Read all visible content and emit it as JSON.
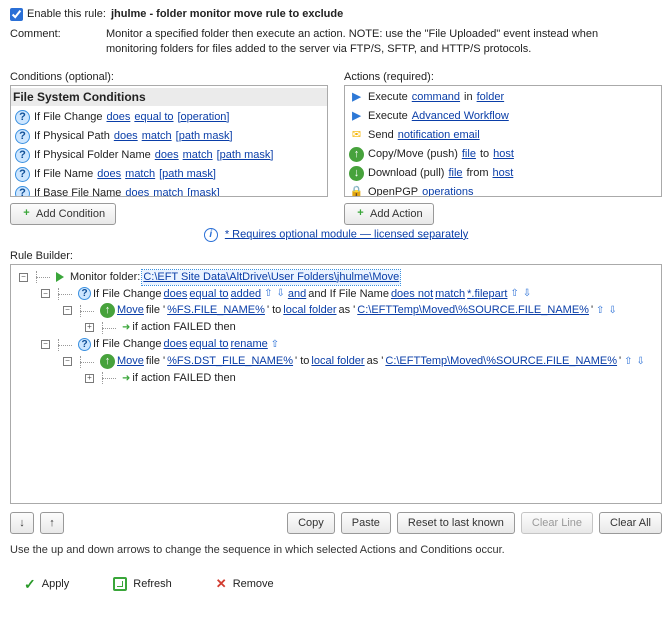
{
  "header": {
    "enable_label": "Enable this rule:",
    "rule_name": "jhulme - folder monitor move rule to exclude",
    "comment_label": "Comment:",
    "comment_text": "Monitor a specified folder then execute an action. NOTE: use the \"File Uploaded\" event instead when monitoring folders for files added to the server via FTP/S, SFTP, and HTTP/S protocols."
  },
  "conditions": {
    "label": "Conditions (optional):",
    "group_header": "File System Conditions",
    "rows": [
      {
        "pre": "If File Change ",
        "a": "does",
        "b": "equal to",
        "c": "[operation]"
      },
      {
        "pre": "If Physical Path ",
        "a": "does",
        "b": "match",
        "c": "[path mask]"
      },
      {
        "pre": "If Physical Folder Name ",
        "a": "does",
        "b": "match",
        "c": "[path mask]"
      },
      {
        "pre": "If File Name ",
        "a": "does",
        "b": "match",
        "c": "[path mask]"
      },
      {
        "pre": "If Base File Name ",
        "a": "does",
        "b": "match",
        "c": "[mask]"
      }
    ],
    "add_button": "Add Condition"
  },
  "actions": {
    "label": "Actions (required):",
    "rows": [
      {
        "icon": "run",
        "parts": [
          [
            "",
            "Execute "
          ],
          [
            "link",
            "command"
          ],
          [
            "",
            " in "
          ],
          [
            "link",
            "folder"
          ]
        ]
      },
      {
        "icon": "run",
        "parts": [
          [
            "",
            "Execute "
          ],
          [
            "link",
            "Advanced Workflow"
          ]
        ]
      },
      {
        "icon": "mail",
        "parts": [
          [
            "",
            "Send "
          ],
          [
            "link",
            "notification email"
          ]
        ]
      },
      {
        "icon": "up",
        "parts": [
          [
            "",
            "Copy/Move (push) "
          ],
          [
            "link",
            "file"
          ],
          [
            "",
            " to "
          ],
          [
            "link",
            "host"
          ]
        ]
      },
      {
        "icon": "down",
        "parts": [
          [
            "",
            "Download (pull) "
          ],
          [
            "link",
            "file"
          ],
          [
            "",
            " from "
          ],
          [
            "link",
            "host"
          ]
        ]
      },
      {
        "icon": "lock",
        "parts": [
          [
            "",
            "OpenPGP "
          ],
          [
            "link",
            "operations"
          ]
        ]
      }
    ],
    "add_button": "Add Action"
  },
  "license": {
    "text": "* Requires optional module — licensed separately"
  },
  "builder": {
    "label": "Rule Builder:",
    "root": {
      "pre": "Monitor folder: ",
      "folder": "C:\\EFT Site Data\\AltDrive\\User Folders\\jhulme\\Move"
    },
    "branches": [
      {
        "cond": {
          "pre1": "If File Change ",
          "a": "does",
          "b": "equal to",
          "c": "added",
          "mid": " and If File Name ",
          "d": "does not",
          "e": "match",
          "f": "*.filepart"
        },
        "action": {
          "pre": " file '",
          "file": "%FS.FILE_NAME%",
          "mid1": "' to ",
          "dest": "local folder",
          "mid2": " as '",
          "as": "C:\\EFTTemp\\Moved\\%SOURCE.FILE_NAME%",
          "post": "' ",
          "verb": "Move"
        },
        "fail": "if action FAILED then"
      },
      {
        "cond": {
          "pre1": "If File Change ",
          "a": "does",
          "b": "equal to",
          "c": "rename"
        },
        "action": {
          "pre": " file '",
          "file": "%FS.DST_FILE_NAME%",
          "mid1": "' to ",
          "dest": "local folder",
          "mid2": " as '",
          "as": "C:\\EFTTemp\\Moved\\%SOURCE.FILE_NAME%",
          "post": "' ",
          "verb": "Move"
        },
        "fail": "if action FAILED then"
      }
    ]
  },
  "bottom": {
    "copy": "Copy",
    "paste": "Paste",
    "reset": "Reset to last known",
    "clear_line": "Clear Line",
    "clear_all": "Clear All"
  },
  "hint": "Use the up and down arrows to change the sequence in which selected Actions and Conditions occur.",
  "legend": {
    "apply": "Apply",
    "refresh": "Refresh",
    "remove": "Remove"
  }
}
